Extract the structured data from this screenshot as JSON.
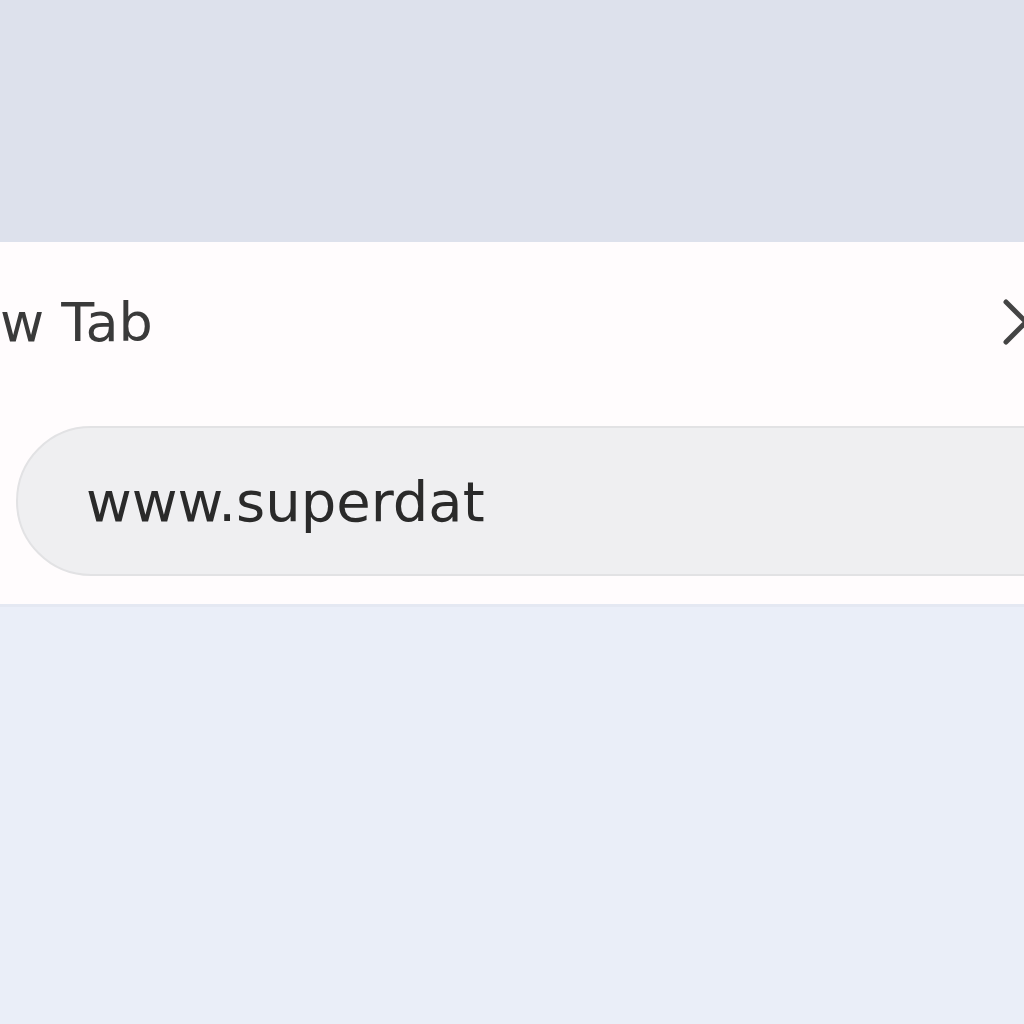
{
  "tab": {
    "title": "w Tab"
  },
  "address_bar": {
    "value": "www.superdat"
  }
}
